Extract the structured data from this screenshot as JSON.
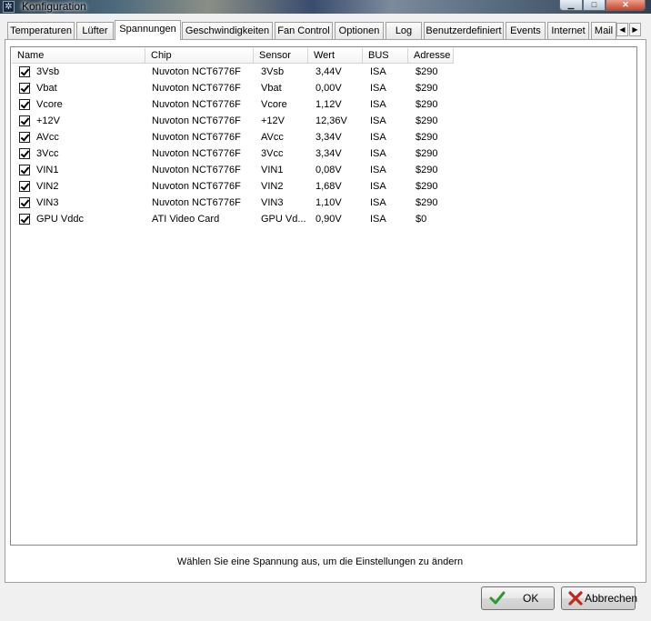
{
  "window": {
    "title": "Konfiguration"
  },
  "tabs": [
    {
      "label": "Temperaturen"
    },
    {
      "label": "Lüfter"
    },
    {
      "label": "Spannungen"
    },
    {
      "label": "Geschwindigkeiten"
    },
    {
      "label": "Fan Control"
    },
    {
      "label": "Optionen"
    },
    {
      "label": "Log"
    },
    {
      "label": "Benutzerdefiniert"
    },
    {
      "label": "Events"
    },
    {
      "label": "Internet"
    },
    {
      "label": "Mail"
    }
  ],
  "active_tab": "Spannungen",
  "table": {
    "columns": [
      "Name",
      "Chip",
      "Sensor",
      "Wert",
      "BUS",
      "Adresse"
    ],
    "rows": [
      {
        "checked": true,
        "name": "3Vsb",
        "chip": "Nuvoton NCT6776F",
        "sensor": "3Vsb",
        "wert": "3,44V",
        "bus": "ISA",
        "adresse": "$290"
      },
      {
        "checked": true,
        "name": "Vbat",
        "chip": "Nuvoton NCT6776F",
        "sensor": "Vbat",
        "wert": "0,00V",
        "bus": "ISA",
        "adresse": "$290"
      },
      {
        "checked": true,
        "name": "Vcore",
        "chip": "Nuvoton NCT6776F",
        "sensor": "Vcore",
        "wert": "1,12V",
        "bus": "ISA",
        "adresse": "$290"
      },
      {
        "checked": true,
        "name": "+12V",
        "chip": "Nuvoton NCT6776F",
        "sensor": "+12V",
        "wert": "12,36V",
        "bus": "ISA",
        "adresse": "$290"
      },
      {
        "checked": true,
        "name": "AVcc",
        "chip": "Nuvoton NCT6776F",
        "sensor": "AVcc",
        "wert": "3,34V",
        "bus": "ISA",
        "adresse": "$290"
      },
      {
        "checked": true,
        "name": "3Vcc",
        "chip": "Nuvoton NCT6776F",
        "sensor": "3Vcc",
        "wert": "3,34V",
        "bus": "ISA",
        "adresse": "$290"
      },
      {
        "checked": true,
        "name": "VIN1",
        "chip": "Nuvoton NCT6776F",
        "sensor": "VIN1",
        "wert": "0,08V",
        "bus": "ISA",
        "adresse": "$290"
      },
      {
        "checked": true,
        "name": "VIN2",
        "chip": "Nuvoton NCT6776F",
        "sensor": "VIN2",
        "wert": "1,68V",
        "bus": "ISA",
        "adresse": "$290"
      },
      {
        "checked": true,
        "name": "VIN3",
        "chip": "Nuvoton NCT6776F",
        "sensor": "VIN3",
        "wert": "1,10V",
        "bus": "ISA",
        "adresse": "$290"
      },
      {
        "checked": true,
        "name": "GPU Vddc",
        "chip": "ATI Video Card",
        "sensor": "GPU Vd...",
        "wert": "0,90V",
        "bus": "ISA",
        "adresse": "$0"
      }
    ]
  },
  "status_text": "Wählen Sie eine Spannung aus, um die Einstellungen zu ändern",
  "buttons": {
    "ok": "OK",
    "cancel": "Abbrechen"
  },
  "colors": {
    "ok_check": "#2e9a2e",
    "cancel_x": "#c0281c"
  },
  "icons": {
    "app": "app-icon",
    "ok": "checkmark-icon",
    "cancel": "x-icon",
    "scroll_left": "arrow-left-icon",
    "scroll_right": "arrow-right-icon"
  }
}
